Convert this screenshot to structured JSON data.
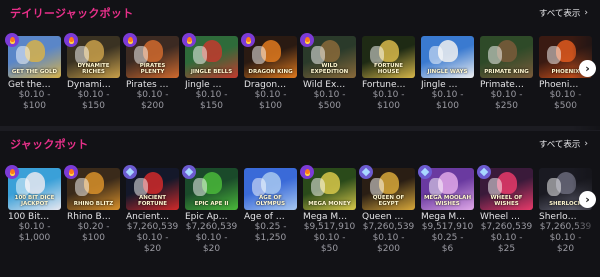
{
  "daily_jackpot": {
    "title": "デイリージャックポット",
    "see_all": "すべて表示",
    "games": [
      {
        "name": "Get the…",
        "thumb_label": "GET THE GOLD",
        "bg": "#5a86c8",
        "bg2": "#d7b24a",
        "badge": "fire",
        "bet_min": "$0.10 -",
        "bet_max": "$100"
      },
      {
        "name": "Dynami…",
        "thumb_label": "DYNAMITE RICHES",
        "bg": "#3a3222",
        "bg2": "#c9a04a",
        "badge": "fire",
        "bet_min": "$0.10 -",
        "bet_max": "$150"
      },
      {
        "name": "Pirates …",
        "thumb_label": "PIRATES PLENTY",
        "bg": "#3c2a22",
        "bg2": "#d06a2e",
        "badge": "fire",
        "bet_min": "$0.10 -",
        "bet_max": "$200"
      },
      {
        "name": "Jingle …",
        "thumb_label": "JINGLE BELLS",
        "bg": "#2e6b3a",
        "bg2": "#c23a2e",
        "badge": "fire",
        "bet_min": "$0.10 -",
        "bet_max": "$150"
      },
      {
        "name": "Dragon…",
        "thumb_label": "DRAGON KING",
        "bg": "#2a1a12",
        "bg2": "#e07a1e",
        "badge": "fire",
        "bet_min": "$0.10 -",
        "bet_max": "$100"
      },
      {
        "name": "Wild Ex…",
        "thumb_label": "WILD EXPEDITION",
        "bg": "#2a3a2a",
        "bg2": "#8a6a3a",
        "badge": "fire",
        "bet_min": "$0.10 -",
        "bet_max": "$500"
      },
      {
        "name": "Fortune…",
        "thumb_label": "FORTUNE HOUSE",
        "bg": "#1e2a14",
        "bg2": "#d8b84a",
        "badge": "",
        "bet_min": "$0.10 -",
        "bet_max": "$100"
      },
      {
        "name": "Jingle …",
        "thumb_label": "JINGLE WAYS",
        "bg": "#3a7ad0",
        "bg2": "#f0f0f0",
        "badge": "",
        "bet_min": "$0.10 -",
        "bet_max": "$100"
      },
      {
        "name": "Primate…",
        "thumb_label": "PRIMATE KING",
        "bg": "#2e4a28",
        "bg2": "#7a5a3a",
        "badge": "",
        "bet_min": "$0.10 -",
        "bet_max": "$250"
      },
      {
        "name": "Phoeni…",
        "thumb_label": "PHOENIX",
        "bg": "#3a1a12",
        "bg2": "#e05a1e",
        "badge": "",
        "bet_min": "$0.10 -",
        "bet_max": "$500"
      }
    ]
  },
  "jackpot": {
    "title": "ジャックポット",
    "see_all": "すべて表示",
    "games": [
      {
        "name": "100 Bit…",
        "thumb_label": "100 BIT DICE JACKPOT",
        "bg": "#3aa0d8",
        "bg2": "#e8e8f0",
        "badge": "fire",
        "bet_min": "$0.10 -",
        "bet_max": "$1,000",
        "jackpot": ""
      },
      {
        "name": "Rhino B…",
        "thumb_label": "RHINO BLITZ",
        "bg": "#3a2a1a",
        "bg2": "#d8902a",
        "badge": "fire",
        "bet_min": "$0.20 -",
        "bet_max": "$100",
        "jackpot": ""
      },
      {
        "name": "Ancient…",
        "thumb_label": "ANCIENT FORTUNE",
        "bg": "#14182a",
        "bg2": "#d02a2a",
        "badge": "gem",
        "bet_min": "$7,260,539",
        "bet_max": "$0.10 -",
        "jackpot": "$20"
      },
      {
        "name": "Epic Ap…",
        "thumb_label": "EPIC APE II",
        "bg": "#1a4a2a",
        "bg2": "#4ab83a",
        "badge": "gem",
        "bet_min": "$7,260,539",
        "bet_max": "$0.10 -",
        "jackpot": "$20"
      },
      {
        "name": "Age of …",
        "thumb_label": "AGE OF OLYMPUS",
        "bg": "#3a6ad8",
        "bg2": "#a8c8f0",
        "badge": "",
        "bet_min": "$0.25 -",
        "bet_max": "$1,250",
        "jackpot": ""
      },
      {
        "name": "Mega M…",
        "thumb_label": "MEGA MONEY",
        "bg": "#2a4a1a",
        "bg2": "#d8c84a",
        "badge": "fire",
        "bet_min": "$9,517,910",
        "bet_max": "$0.10 -",
        "jackpot": "$50"
      },
      {
        "name": "Queen …",
        "thumb_label": "QUEEN OF EGYPT",
        "bg": "#2a1e14",
        "bg2": "#d8a83a",
        "badge": "gem",
        "bet_min": "$7,260,539",
        "bet_max": "$0.10 -",
        "jackpot": "$200"
      },
      {
        "name": "Mega M…",
        "thumb_label": "MEGA MOOLAH WISHES",
        "bg": "#6a3aa0",
        "bg2": "#e0a8e8",
        "badge": "gem",
        "bet_min": "$9,517,910",
        "bet_max": "$0.25 -",
        "jackpot": "$6"
      },
      {
        "name": "Wheel …",
        "thumb_label": "WHEEL OF WISHES",
        "bg": "#3a1a3a",
        "bg2": "#e83a6a",
        "badge": "gem",
        "bet_min": "$7,260,539",
        "bet_max": "$0.10 -",
        "jackpot": "$25"
      },
      {
        "name": "Sherlo…",
        "thumb_label": "SHERLOCK",
        "bg": "#1a1a22",
        "bg2": "#6a6a7a",
        "badge": "",
        "bet_min": "$7,260,539",
        "bet_max": "$0.10 -",
        "jackpot": "$20"
      }
    ]
  },
  "icons": {
    "hot_badge": "fire-icon",
    "jackpot_badge": "gem-icon",
    "next": "chevron-right-icon",
    "see_all_chevron": "chevron-right-icon"
  },
  "colors": {
    "accent": "#e8308a",
    "badge": "#7c3bd6",
    "background": "#0e0e10"
  }
}
